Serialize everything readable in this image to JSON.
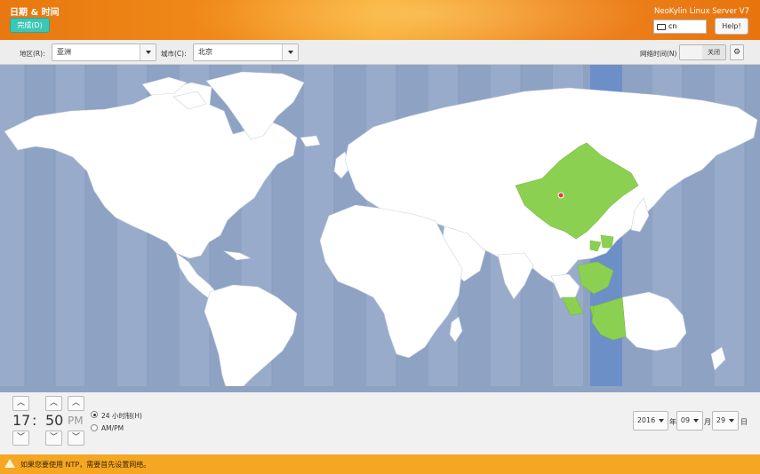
{
  "header": {
    "title": "日期 & 时间",
    "done_label": "完成(D)",
    "product": "NeoKylin Linux Server V7",
    "keyboard_layout": "cn",
    "help_label": "Help!"
  },
  "toolbar": {
    "region_label": "地区(R):",
    "region_value": "亚洲",
    "city_label": "城市(C):",
    "city_value": "北京",
    "ntp_label": "网络时间(N)",
    "ntp_state": "关闭",
    "gear_icon": "gear-icon"
  },
  "map": {
    "ocean_color": "#8ea2c4",
    "land_color": "#ffffff",
    "selected_zone_color": "#8cd052",
    "selected_band_color": "#6c8fc8",
    "pin_color": "#e03c3c"
  },
  "time": {
    "hour": "17",
    "separator": ":",
    "minute": "50",
    "ampm": "PM",
    "format_24h_label": "24 小时制(H)",
    "format_ampm_label": "AM/PM",
    "selected_format": "24h",
    "up_icon": "chevron-up-icon",
    "down_icon": "chevron-down-icon"
  },
  "date": {
    "year": "2016",
    "year_unit": "年",
    "month": "09",
    "month_unit": "月",
    "day": "29",
    "day_unit": "日"
  },
  "warning": {
    "text": "如果您要使用 NTP，需要首先设置网络。",
    "icon": "warning-icon"
  }
}
